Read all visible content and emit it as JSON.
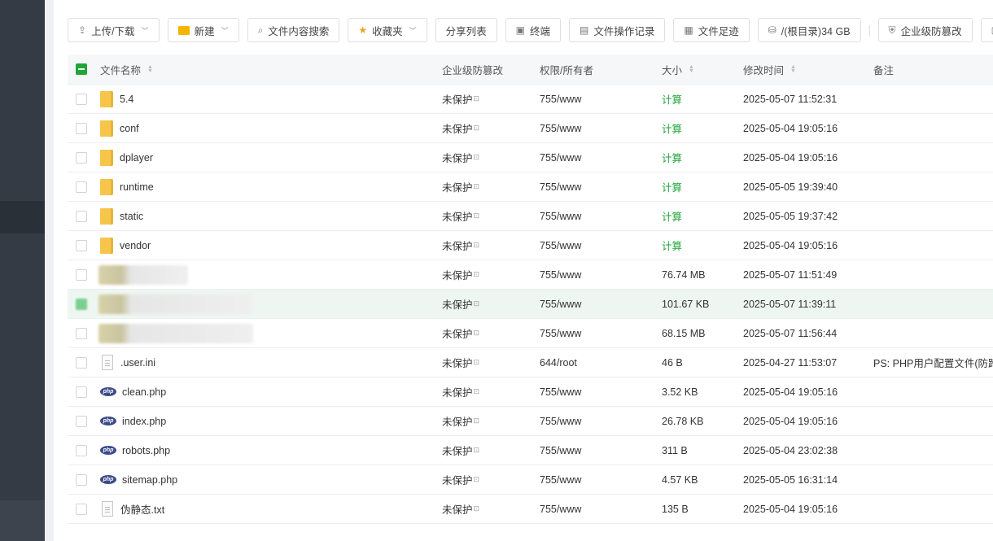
{
  "toolbar": {
    "upload": "上传/下载",
    "new": "新建",
    "search": "文件内容搜索",
    "favorites": "收藏夹",
    "share_list": "分享列表",
    "terminal": "终端",
    "op_log": "文件操作记录",
    "footprint": "文件足迹",
    "disk": "/(根目录)34 GB",
    "tamper": "企业级防篡改"
  },
  "table": {
    "headers": {
      "name": "文件名称",
      "protect": "企业级防篡改",
      "perm": "权限/所有者",
      "size": "大小",
      "mtime": "修改时间",
      "note": "备注"
    },
    "rows": [
      {
        "name": "5.4",
        "type": "folder",
        "protect": "未保护",
        "perm": "755/www",
        "size": "计算",
        "mtime": "2025-05-07 11:52:31",
        "note": ""
      },
      {
        "name": "conf",
        "type": "folder",
        "protect": "未保护",
        "perm": "755/www",
        "size": "计算",
        "mtime": "2025-05-04 19:05:16",
        "note": ""
      },
      {
        "name": "dplayer",
        "type": "folder",
        "protect": "未保护",
        "perm": "755/www",
        "size": "计算",
        "mtime": "2025-05-04 19:05:16",
        "note": ""
      },
      {
        "name": "runtime",
        "type": "folder",
        "protect": "未保护",
        "perm": "755/www",
        "size": "计算",
        "mtime": "2025-05-05 19:39:40",
        "note": ""
      },
      {
        "name": "static",
        "type": "folder",
        "protect": "未保护",
        "perm": "755/www",
        "size": "计算",
        "mtime": "2025-05-05 19:37:42",
        "note": ""
      },
      {
        "name": "vendor",
        "type": "folder",
        "protect": "未保护",
        "perm": "755/www",
        "size": "计算",
        "mtime": "2025-05-04 19:05:16",
        "note": ""
      },
      {
        "name": "",
        "type": "blurred",
        "protect": "未保护",
        "perm": "755/www",
        "size": "76.74 MB",
        "mtime": "2025-05-07 11:51:49",
        "note": ""
      },
      {
        "name": "",
        "type": "blurred",
        "protect": "未保护",
        "perm": "755/www",
        "size": "101.67 KB",
        "mtime": "2025-05-07 11:39:11",
        "note": ""
      },
      {
        "name": "",
        "type": "blurred",
        "protect": "未保护",
        "perm": "755/www",
        "size": "68.15 MB",
        "mtime": "2025-05-07 11:56:44",
        "note": ""
      },
      {
        "name": ".user.ini",
        "type": "file",
        "protect": "未保护",
        "perm": "644/root",
        "size": "46 B",
        "mtime": "2025-04-27 11:53:07",
        "note": "PS: PHP用户配置文件(防跨站"
      },
      {
        "name": "clean.php",
        "type": "php",
        "protect": "未保护",
        "perm": "755/www",
        "size": "3.52 KB",
        "mtime": "2025-05-04 19:05:16",
        "note": ""
      },
      {
        "name": "index.php",
        "type": "php",
        "protect": "未保护",
        "perm": "755/www",
        "size": "26.78 KB",
        "mtime": "2025-05-04 19:05:16",
        "note": ""
      },
      {
        "name": "robots.php",
        "type": "php",
        "protect": "未保护",
        "perm": "755/www",
        "size": "311 B",
        "mtime": "2025-05-04 23:02:38",
        "note": ""
      },
      {
        "name": "sitemap.php",
        "type": "php",
        "protect": "未保护",
        "perm": "755/www",
        "size": "4.57 KB",
        "mtime": "2025-05-05 16:31:14",
        "note": ""
      },
      {
        "name": "伪静态.txt",
        "type": "file",
        "protect": "未保护",
        "perm": "755/www",
        "size": "135 B",
        "mtime": "2025-05-04 19:05:16",
        "note": ""
      }
    ]
  },
  "colors": {
    "accent": "#20a53a",
    "sidebar": "#343b44",
    "php_badge": "#3d4b8a",
    "folder": "#f5c64a"
  },
  "icons": {
    "php_badge_text": "php"
  }
}
